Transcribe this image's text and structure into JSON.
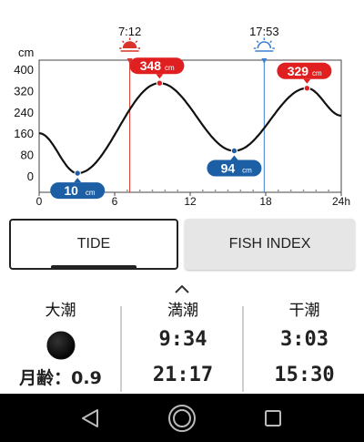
{
  "chart_data": {
    "type": "line",
    "y_unit_label": "cm",
    "y_ticks": [
      "400",
      "320",
      "240",
      "160",
      "80",
      "0"
    ],
    "x_ticks": [
      "0",
      "6",
      "12",
      "18",
      "24h"
    ],
    "x_range": [
      0,
      24
    ],
    "y_range": [
      -20,
      430
    ],
    "line_color": "#111111",
    "sunrise": {
      "time": "7:12",
      "hour": 7.2,
      "color": "#d9342b"
    },
    "sunset": {
      "time": "17:53",
      "hour": 17.88,
      "color": "#3b7fd6"
    },
    "extremes": [
      {
        "hour": 3.05,
        "value": 10,
        "label": "10",
        "unit": "cm",
        "kind": "low",
        "color": "#1d5fa5"
      },
      {
        "hour": 9.57,
        "value": 348,
        "label": "348",
        "unit": "cm",
        "kind": "high",
        "color": "#e02020"
      },
      {
        "hour": 15.5,
        "value": 94,
        "label": "94",
        "unit": "cm",
        "kind": "low",
        "color": "#1d5fa5"
      },
      {
        "hour": 21.28,
        "value": 329,
        "label": "329",
        "unit": "cm",
        "kind": "high",
        "color": "#e02020"
      }
    ],
    "series": [
      {
        "x": [
          0,
          3.05,
          9.57,
          15.5,
          21.28,
          24
        ],
        "values": [
          160,
          10,
          348,
          94,
          329,
          226
        ]
      }
    ]
  },
  "tabs": {
    "tide": "TIDE",
    "fish_index": "FISH INDEX"
  },
  "info": {
    "tide_type": "大潮",
    "moon_age_label": "月齢：0.9",
    "high_tide": {
      "title": "満潮",
      "times": [
        "9:34",
        "21:17"
      ]
    },
    "low_tide": {
      "title": "干潮",
      "times": [
        "3:03",
        "15:30"
      ]
    }
  },
  "icons": {
    "expand": "chevron-up-icon",
    "moon": "new-moon-icon",
    "sunrise": "sunrise-icon",
    "sunset": "sunset-icon",
    "nav": [
      "back-icon",
      "home-icon",
      "recent-apps-icon"
    ]
  }
}
